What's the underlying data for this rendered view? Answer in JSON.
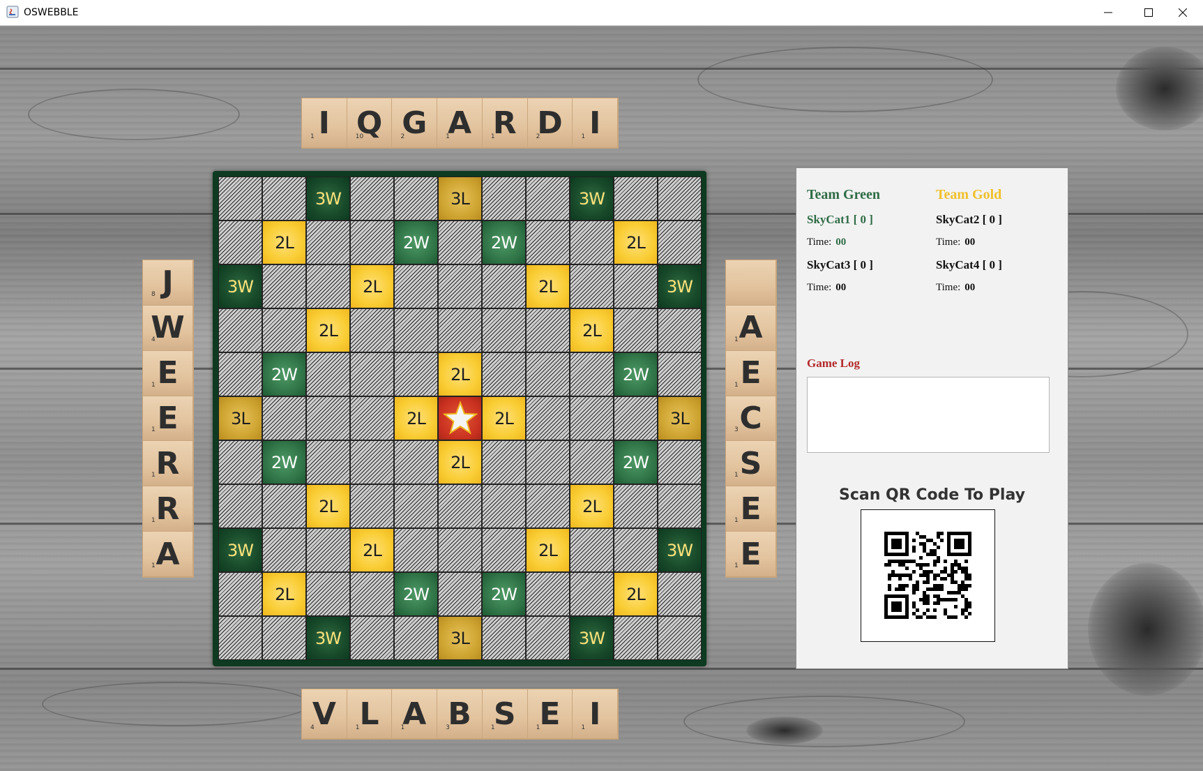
{
  "window": {
    "title": "OSWEBBLE"
  },
  "racks": {
    "top": [
      {
        "letter": "I",
        "score": "1"
      },
      {
        "letter": "Q",
        "score": "10"
      },
      {
        "letter": "G",
        "score": "2"
      },
      {
        "letter": "A",
        "score": "1"
      },
      {
        "letter": "R",
        "score": "1"
      },
      {
        "letter": "D",
        "score": "2"
      },
      {
        "letter": "I",
        "score": "1"
      }
    ],
    "bottom": [
      {
        "letter": "V",
        "score": "4"
      },
      {
        "letter": "L",
        "score": "1"
      },
      {
        "letter": "A",
        "score": "1"
      },
      {
        "letter": "B",
        "score": "3"
      },
      {
        "letter": "S",
        "score": "1"
      },
      {
        "letter": "E",
        "score": "1"
      },
      {
        "letter": "I",
        "score": "1"
      }
    ],
    "left": [
      {
        "letter": "J",
        "score": "8"
      },
      {
        "letter": "W",
        "score": "4"
      },
      {
        "letter": "E",
        "score": "1"
      },
      {
        "letter": "E",
        "score": "1"
      },
      {
        "letter": "R",
        "score": "1"
      },
      {
        "letter": "R",
        "score": "1"
      },
      {
        "letter": "A",
        "score": "1"
      }
    ],
    "right": [
      {
        "letter": "",
        "score": ""
      },
      {
        "letter": "A",
        "score": "1"
      },
      {
        "letter": "E",
        "score": "1"
      },
      {
        "letter": "C",
        "score": "3"
      },
      {
        "letter": "S",
        "score": "1"
      },
      {
        "letter": "E",
        "score": "1"
      },
      {
        "letter": "E",
        "score": "1"
      }
    ]
  },
  "board": {
    "rows": [
      [
        "",
        "",
        "3W",
        "",
        "",
        "3L",
        "",
        "",
        "3W",
        "",
        ""
      ],
      [
        "",
        "2L",
        "",
        "",
        "2W",
        "",
        "2W",
        "",
        "",
        "2L",
        ""
      ],
      [
        "3W",
        "",
        "",
        "2L",
        "",
        "",
        "",
        "2L",
        "",
        "",
        "3W"
      ],
      [
        "",
        "",
        "2L",
        "",
        "",
        "",
        "",
        "",
        "2L",
        "",
        ""
      ],
      [
        "",
        "2W",
        "",
        "",
        "",
        "2L",
        "",
        "",
        "",
        "2W",
        ""
      ],
      [
        "3L",
        "",
        "",
        "",
        "2L",
        "★",
        "2L",
        "",
        "",
        "",
        "3L"
      ],
      [
        "",
        "2W",
        "",
        "",
        "",
        "2L",
        "",
        "",
        "",
        "2W",
        ""
      ],
      [
        "",
        "",
        "2L",
        "",
        "",
        "",
        "",
        "",
        "2L",
        "",
        ""
      ],
      [
        "3W",
        "",
        "",
        "2L",
        "",
        "",
        "",
        "2L",
        "",
        "",
        "3W"
      ],
      [
        "",
        "2L",
        "",
        "",
        "2W",
        "",
        "2W",
        "",
        "",
        "2L",
        ""
      ],
      [
        "",
        "",
        "3W",
        "",
        "",
        "3L",
        "",
        "",
        "3W",
        "",
        ""
      ]
    ]
  },
  "panel": {
    "team_green": "Team Green",
    "team_gold": "Team Gold",
    "players": [
      {
        "name": "SkyCat1  [ 0 ]",
        "time_label": "Time:",
        "time": "00"
      },
      {
        "name": "SkyCat2  [ 0 ]",
        "time_label": "Time:",
        "time": "00"
      },
      {
        "name": "SkyCat3  [ 0 ]",
        "time_label": "Time:",
        "time": "00"
      },
      {
        "name": "SkyCat4  [ 0 ]",
        "time_label": "Time:",
        "time": "00"
      }
    ],
    "game_log_title": "Game Log",
    "game_log_text": "",
    "qr_title": "Scan QR Code To Play"
  },
  "colors": {
    "team_green": "#2e6b44",
    "team_gold": "#f0c02b",
    "game_log": "#b3282a",
    "board_border": "#0d3a20",
    "double_letter": "#f9cd34",
    "triple_letter": "#cfa532",
    "double_word": "#2f7346",
    "triple_word": "#184a2a",
    "center_star": "#c8301f"
  }
}
